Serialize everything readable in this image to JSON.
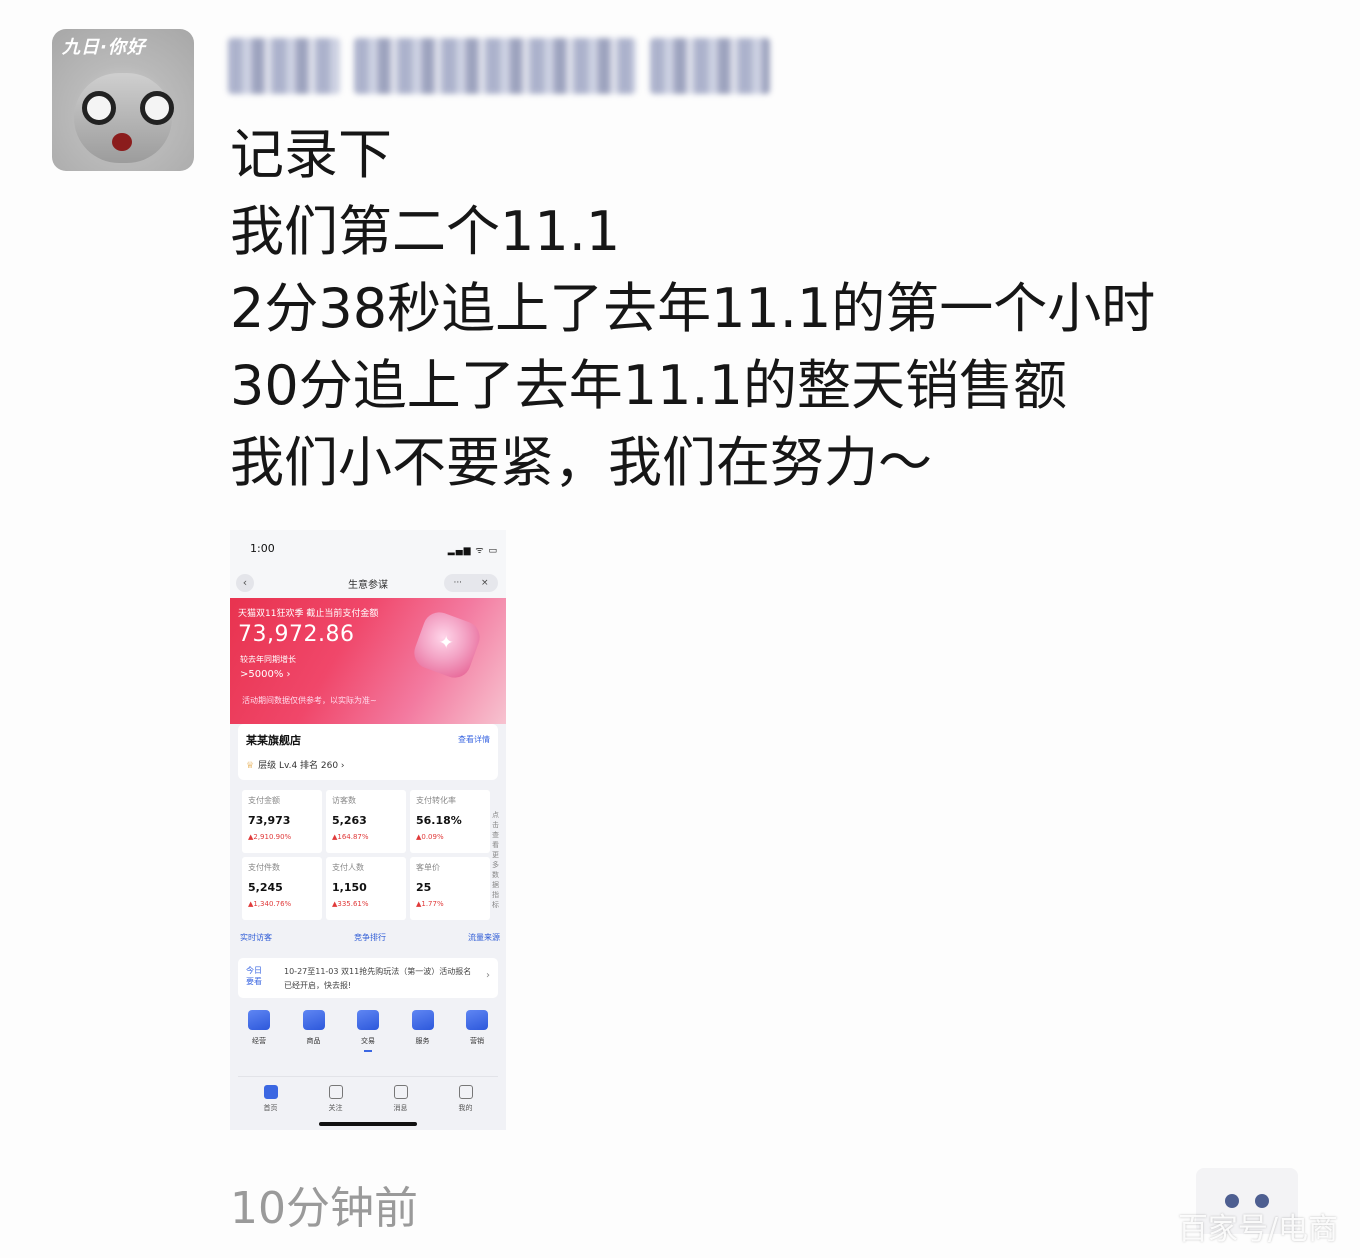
{
  "avatar": {
    "tag": "九日·你好"
  },
  "post": {
    "lines": [
      "记录下",
      "我们第二个11.1",
      "2分38秒追上了去年11.1的第一个小时",
      "30分追上了去年11.1的整天销售额",
      "我们小不要紧，我们在努力～"
    ]
  },
  "screenshot": {
    "status": {
      "time": "1:00",
      "signal": "▂▄▆ ᯤ ▭"
    },
    "nav": {
      "back": "‹",
      "title": "生意参谋",
      "more": "···",
      "close": "×"
    },
    "hero": {
      "headline": "天猫双11狂欢季 截止当前支付金额",
      "amount": "73,972.86",
      "sub": "较去年同期增长",
      "pct": ">5000% ›",
      "note": "活动期间数据仅供参考，以实际为准~",
      "badge": "✦"
    },
    "store": {
      "name": "某某旗舰店",
      "link": "查看详情",
      "level": "层级 Lv.4  排名 260 ›",
      "level_icon": "♕"
    },
    "metrics": [
      {
        "label": "支付金额",
        "value": "73,973",
        "change": "▲2,910.90%"
      },
      {
        "label": "访客数",
        "value": "5,263",
        "change": "▲164.87%"
      },
      {
        "label": "支付转化率",
        "value": "56.18%",
        "change": "▲0.09%"
      },
      {
        "label": "支付件数",
        "value": "5,245",
        "change": "▲1,340.76%"
      },
      {
        "label": "支付人数",
        "value": "1,150",
        "change": "▲335.61%"
      },
      {
        "label": "客单价",
        "value": "25",
        "change": "▲1.77%"
      }
    ],
    "side": "点击查看更多数据指标",
    "shortcuts": [
      "实时访客",
      "竞争排行",
      "流量来源"
    ],
    "notice": {
      "tag": "今日\n要看",
      "text": "10-27至11-03 双11抢先购玩法（第一波）活动报名已经开启，快去报!",
      "arrow": "›"
    },
    "tools": [
      {
        "label": "经营"
      },
      {
        "label": "商品"
      },
      {
        "label": "交易"
      },
      {
        "label": "服务"
      },
      {
        "label": "营销"
      }
    ],
    "tabs": [
      {
        "label": "首页"
      },
      {
        "label": "关注"
      },
      {
        "label": "消息"
      },
      {
        "label": "我的"
      }
    ]
  },
  "footer": {
    "timestamp": "10分钟前",
    "watermark": "百家号/电商"
  }
}
